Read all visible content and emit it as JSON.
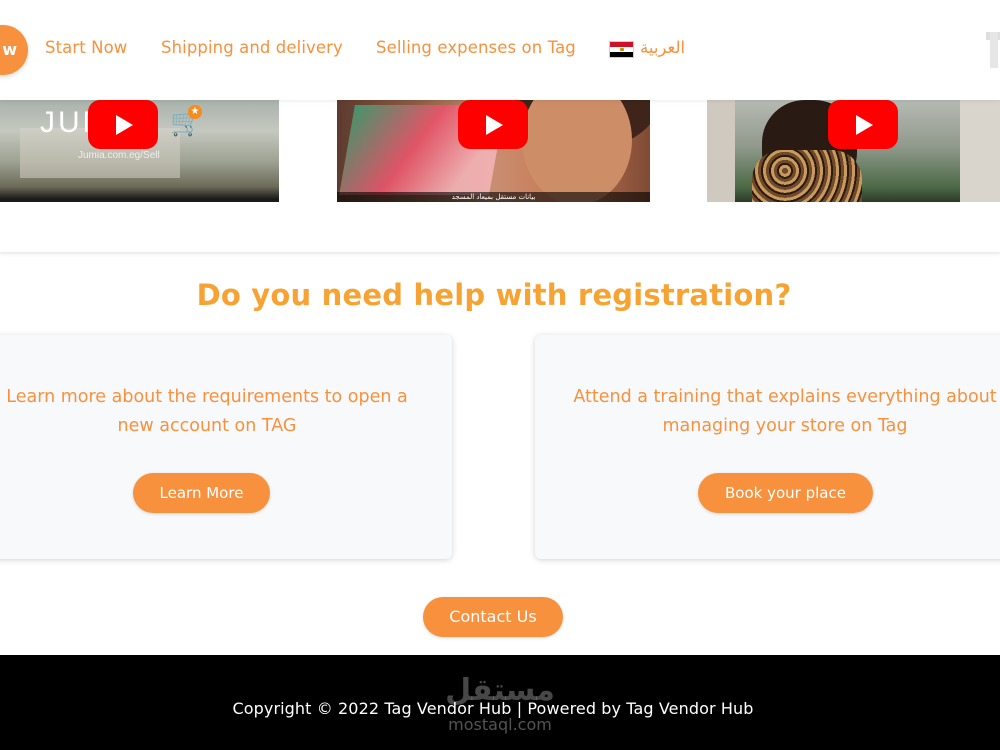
{
  "nav": {
    "partial_button_label": "w",
    "links": [
      "Start Now",
      "Shipping and delivery",
      "Selling expenses on Tag"
    ],
    "language_label": "العربية",
    "flag_icon": "egypt-flag-icon",
    "accent_color": "#f7913d"
  },
  "videos": [
    {
      "logo_text": "JUMIA",
      "subtitle": "Jumia.com.eg/Sell",
      "play_icon": "youtube-play-icon"
    },
    {
      "caption": "بيانات مستقل بميعاد المسجد",
      "play_icon": "youtube-play-icon"
    },
    {
      "play_icon": "youtube-play-icon"
    }
  ],
  "help": {
    "title": "Do you need help with registration?",
    "title_color": "#f7a334",
    "cards": [
      {
        "text_line1": "Learn more about the requirements to open a",
        "text_line2": "new account on TAG",
        "button": "Learn More"
      },
      {
        "text_line1": "Attend a training that explains everything about",
        "text_line2": "managing your store on Tag",
        "button": "Book your place"
      }
    ],
    "contact_button": "Contact Us"
  },
  "footer": {
    "copyright": "Copyright © 2022 Tag Vendor Hub | Powered by Tag Vendor Hub",
    "watermark_arabic": "مستقل",
    "watermark_latin": "mostaql.com"
  }
}
